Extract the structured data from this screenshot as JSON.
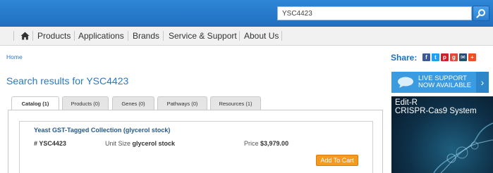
{
  "search": {
    "value": "YSC4423"
  },
  "nav": {
    "items": [
      "Products",
      "Applications",
      "Brands",
      "Service & Support",
      "About Us"
    ]
  },
  "breadcrumb": {
    "home": "Home"
  },
  "share": {
    "label": "Share:"
  },
  "page": {
    "title": "Search results for YSC4423"
  },
  "tabs": [
    "Catalog (1)",
    "Products (0)",
    "Genes (0)",
    "Pathways (0)",
    "Resources (1)"
  ],
  "result": {
    "title": "Yeast GST-Tagged Collection (glycerol stock)",
    "catalog": "# YSC4423",
    "unit_label": "Unit Size",
    "unit_value": "glycerol stock",
    "price_label": "Price",
    "price_value": "$3,979.00",
    "cart_label": "Add To Cart"
  },
  "live_support": {
    "line1": "LIVE SUPPORT",
    "line2": "NOW AVAILABLE"
  },
  "promo": {
    "line1": "Edit-R",
    "line2": "CRISPR-Cas9 System"
  },
  "colors": {
    "brand_blue": "#1f6fc0",
    "link_blue": "#2b79c2",
    "cart_orange": "#f49a1f"
  }
}
